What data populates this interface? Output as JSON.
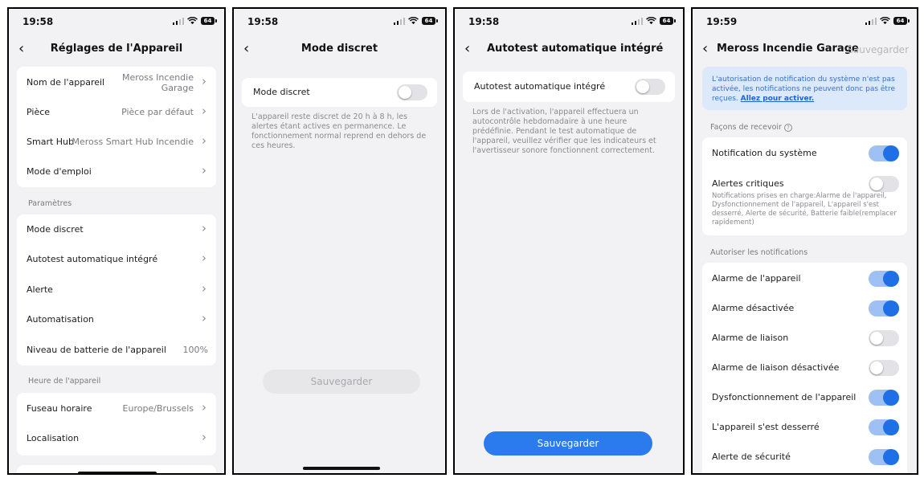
{
  "status": {
    "time_1": "19:58",
    "time_2": "19:58",
    "time_3": "19:58",
    "time_4": "19:59",
    "battery": "64"
  },
  "screen1": {
    "title": "Réglages de l'Appareil",
    "info_rows": [
      {
        "label": "Nom de l'appareil",
        "value": "Meross Incendie Garage"
      },
      {
        "label": "Pièce",
        "value": "Pièce par défaut"
      },
      {
        "label": "Smart Hub",
        "value": "Meross Smart Hub Incendie"
      },
      {
        "label": "Mode d'emploi",
        "value": ""
      }
    ],
    "section_params": "Paramètres",
    "param_rows": [
      {
        "label": "Mode discret"
      },
      {
        "label": "Autotest automatique intégré"
      },
      {
        "label": "Alerte"
      },
      {
        "label": "Automatisation"
      },
      {
        "label": "Niveau de batterie de l'appareil",
        "value": "100%"
      }
    ],
    "section_time": "Heure de l'appareil",
    "time_rows": [
      {
        "label": "Fuseau horaire",
        "value": "Europe/Brussels"
      },
      {
        "label": "Localisation",
        "value": ""
      }
    ],
    "name_line1": "Meross Incendie",
    "name_line2": "Garage"
  },
  "screen2": {
    "title": "Mode discret",
    "toggle_label": "Mode discret",
    "toggle_on": false,
    "description": "L'appareil reste discret de 20 h à 8 h, les alertes étant actives en permanence. Le fonctionnement normal reprend en dehors de ces heures.",
    "save_label": "Sauvegarder"
  },
  "screen3": {
    "title": "Autotest automatique intégré",
    "toggle_label": "Autotest automatique intégré",
    "toggle_on": false,
    "description": "Lors de l'activation, l'appareil effectuera un autocontrôle hebdomadaire à une heure prédéfinie. Pendant le test automatique de l'appareil, veuillez vérifier que les indicateurs et l'avertisseur sonore fonctionnent correctement.",
    "save_label": "Sauvegarder"
  },
  "screen4": {
    "title": "Meross Incendie Garage",
    "save_label": "Sauvegarder",
    "banner_text": "L'autorisation de notification du système n'est pas activée, les notifications ne peuvent donc pas être reçues.",
    "banner_link": "Allez pour activer.",
    "section_receive": "Façons de recevoir",
    "help_glyph": "?",
    "system_notification": {
      "label": "Notification du système",
      "on": true
    },
    "critical_alerts": {
      "label": "Alertes critiques",
      "on": false,
      "description": "Notifications prises en charge:Alarme de l'appareil, Dysfonctionnement de l'appareil, L'appareil s'est desserré, Alerte de sécurité, Batterie faible(remplacer rapidement)"
    },
    "section_allow": "Autoriser les notifications",
    "notifications": [
      {
        "label": "Alarme de l'appareil",
        "on": true
      },
      {
        "label": "Alarme désactivée",
        "on": true
      },
      {
        "label": "Alarme de liaison",
        "on": false
      },
      {
        "label": "Alarme de liaison désactivée",
        "on": false
      },
      {
        "label": "Dysfonctionnement de l'appareil",
        "on": true
      },
      {
        "label": "L'appareil s'est desserré",
        "on": true
      },
      {
        "label": "Alerte de sécurité",
        "on": true
      }
    ]
  },
  "colors": {
    "accent": "#1f6fe6",
    "toggle_track_on": "#9ec0f3",
    "toggle_off": "#e3e3e7",
    "banner_bg": "#dce9fb",
    "background": "#f2f2f4"
  },
  "icons": {
    "back": "chevron-left-icon",
    "row_chevron": "chevron-right-icon",
    "help": "help-circle-icon"
  }
}
